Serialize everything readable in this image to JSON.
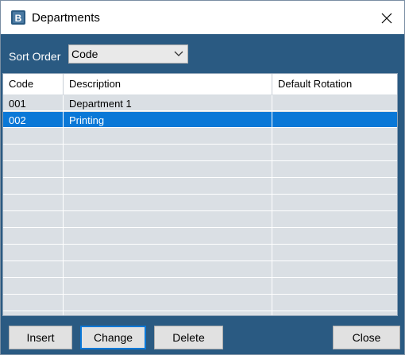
{
  "window": {
    "title": "Departments",
    "app_icon": "app-logo-icon",
    "close_icon": "close-icon"
  },
  "toolbar": {
    "sort_label": "Sort Order",
    "sort_value": "Code"
  },
  "grid": {
    "columns": [
      "Code",
      "Description",
      "Default Rotation"
    ],
    "rows": [
      {
        "code": "001",
        "description": "Department 1",
        "rotation": ""
      },
      {
        "code": "002",
        "description": "Printing",
        "rotation": ""
      }
    ],
    "selected_row": 1
  },
  "buttons": {
    "insert": "Insert",
    "change": "Change",
    "delete": "Delete",
    "close": "Close"
  },
  "colors": {
    "accent": "#2a5a82",
    "selection": "#0a78d7",
    "row_bg": "#dadfe4"
  }
}
